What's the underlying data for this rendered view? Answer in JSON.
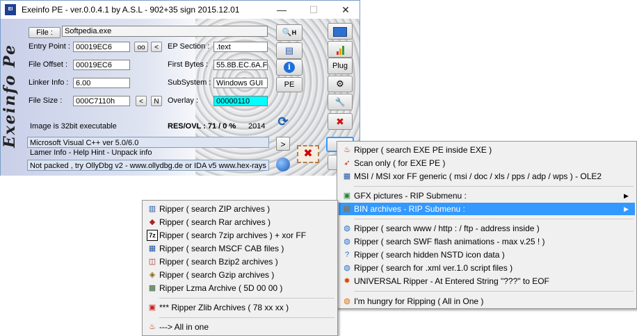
{
  "window": {
    "title": "Exeinfo PE - ver.0.0.4.1  by A.S.L -  902+35 sign  2015.12.01",
    "app_icon_text": "EI",
    "minimize": "—",
    "maximize": "☐",
    "close": "✕",
    "sidebar_logo": "Exeinfo Pe"
  },
  "fields": {
    "file_btn": "File :",
    "file_name": "Softpedia.exe",
    "entry_point_label": "Entry Point :",
    "entry_point": "00019EC6",
    "oo_btn": "oo",
    "lt_btn": "<",
    "ep_section_label": "EP Section :",
    "ep_section": ".text",
    "file_offset_label": "File Offset :",
    "file_offset": "00019EC6",
    "first_bytes_label": "First Bytes :",
    "first_bytes": "55.8B.EC.6A.FF",
    "linker_label": "Linker Info :",
    "linker": "6.00",
    "subsystem_label": "SubSystem :",
    "subsystem": "Windows GUI",
    "file_size_label": "File Size :",
    "file_size": "000C7110h",
    "size_lt": "<",
    "size_n": "N",
    "overlay_label": "Overlay :",
    "overlay": "00000110",
    "overlay_color": "#00ffff",
    "image_type": "Image is 32bit executable",
    "res_ovl": "RES/OVL : 71 / 0 %",
    "year": "2014",
    "compiler": "Microsoft Visual C++ ver 5.0/6.0",
    "lamer_info": "Lamer Info - Help Hint - Unpack info",
    "hint": "Not packed , try OllyDbg v2 - www.ollydbg.de or IDA v5 www.hex-rays",
    "hint_arrow": ">",
    "pe_btn": "PE",
    "plug_btn": "Plug",
    "h_btn": "H"
  },
  "icons": {
    "search": "🔍",
    "database": "▤",
    "info": "i",
    "folder": "▭",
    "chart": "▮",
    "gear": "⚙",
    "tools": "🔧",
    "delete": "✖",
    "refresh": "⟳",
    "globe": "◍",
    "stamp": "✉"
  },
  "colors": {
    "highlight": "#3399ff"
  },
  "menu_main": {
    "items": [
      {
        "icon": "♨",
        "color": "#cc2200",
        "label": "Ripper ( search EXE PE inside EXE )"
      },
      {
        "icon": "➶",
        "color": "#cc2200",
        "label": "Scan only ( for EXE PE )"
      },
      {
        "icon": "▦",
        "color": "#2255aa",
        "label": "MSI / MSI xor FF generic ( msi / doc / xls / pps / adp / wps )  - OLE2"
      },
      {
        "icon": "▣",
        "color": "#228833",
        "label": "GFX pictures    -   RIP Submenu :"
      },
      {
        "icon": "▤",
        "color": "#aa6600",
        "label": "BIN archives    -   RIP Submenu :"
      },
      {
        "icon": "◍",
        "color": "#1e6fc8",
        "label": "Ripper ( search www / http : / ftp   - address inside  )"
      },
      {
        "icon": "◍",
        "color": "#1e6fc8",
        "label": "Ripper ( search SWF flash animations - max v.25 ! )"
      },
      {
        "icon": "?",
        "color": "#1e6fc8",
        "label": "Ripper ( search hidden NSTD icon data )"
      },
      {
        "icon": "◍",
        "color": "#1e6fc8",
        "label": "Ripper ( search for .xml ver.1.0 script files )"
      },
      {
        "icon": "✹",
        "color": "#e04400",
        "label": "UNIVERSAL Ripper  - At Entered String \"???\" to EOF"
      },
      {
        "icon": "◍",
        "color": "#e06a00",
        "label": "I'm hungry for Ripping ( All in One )"
      }
    ],
    "arrow": "▶"
  },
  "menu_sub": {
    "items": [
      {
        "icon": "▥",
        "color": "#2255aa",
        "label": "Ripper ( search ZIP archives )"
      },
      {
        "icon": "◆",
        "color": "#aa2222",
        "label": "Ripper ( search Rar archives )"
      },
      {
        "icon": "7z",
        "color": "#000000",
        "label": "Ripper ( search 7zip archives ) + xor FF"
      },
      {
        "icon": "▦",
        "color": "#2255aa",
        "label": "Ripper ( search MSCF CAB files )"
      },
      {
        "icon": "◫",
        "color": "#aa2222",
        "label": "Ripper ( search Bzip2 archives )"
      },
      {
        "icon": "◈",
        "color": "#886600",
        "label": "Ripper ( search Gzip  archives )"
      },
      {
        "icon": "▩",
        "color": "#336633",
        "label": "Ripper Lzma Archive ( 5D 00 00 )"
      },
      {
        "icon": "▣",
        "color": "#cc2222",
        "label": "*** Ripper Zlib Archives ( 78 xx xx )"
      },
      {
        "icon": "♨",
        "color": "#cc2200",
        "label": "---> All in one"
      }
    ]
  }
}
